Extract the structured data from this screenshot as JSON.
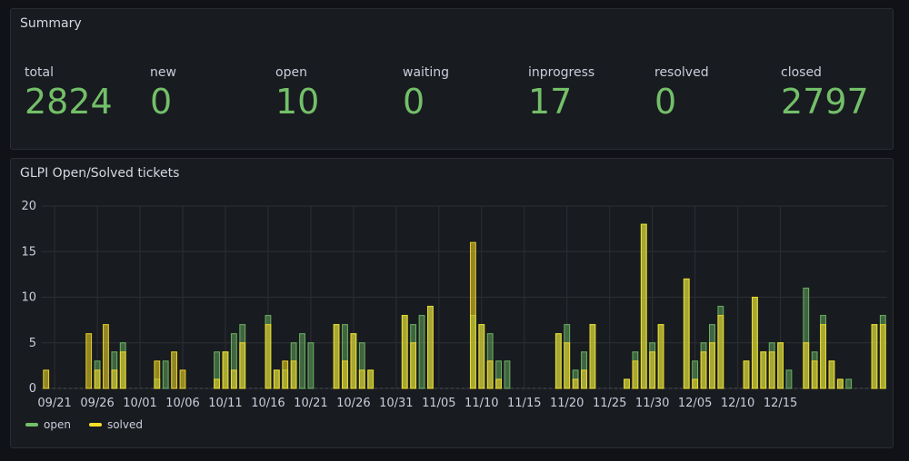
{
  "summary": {
    "title": "Summary",
    "stats": [
      {
        "label": "total",
        "value": "2824"
      },
      {
        "label": "new",
        "value": "0"
      },
      {
        "label": "open",
        "value": "10"
      },
      {
        "label": "waiting",
        "value": "0"
      },
      {
        "label": "inprogress",
        "value": "17"
      },
      {
        "label": "resolved",
        "value": "0"
      },
      {
        "label": "closed",
        "value": "2797"
      }
    ],
    "value_color": "#73bf69"
  },
  "chart_panel": {
    "title": "GLPI Open/Solved tickets"
  },
  "chart_data": {
    "type": "bar",
    "title": "GLPI Open/Solved tickets",
    "x_tick_labels": [
      "09/21",
      "09/26",
      "10/01",
      "10/06",
      "10/11",
      "10/16",
      "10/21",
      "10/26",
      "10/31",
      "11/05",
      "11/10",
      "11/15",
      "11/20",
      "11/25",
      "11/30",
      "12/05",
      "12/10",
      "12/15"
    ],
    "start_date": "09/20",
    "ylim": [
      0,
      20
    ],
    "y_ticks": [
      0,
      5,
      10,
      15,
      20
    ],
    "grid": true,
    "legend_position": "bottom-left",
    "series": [
      {
        "name": "open",
        "color": "#73bf69",
        "values": [
          0,
          0,
          0,
          0,
          0,
          0,
          3,
          0,
          4,
          5,
          0,
          0,
          0,
          1,
          3,
          0,
          0,
          0,
          0,
          0,
          4,
          4,
          6,
          7,
          0,
          0,
          8,
          2,
          2,
          5,
          6,
          5,
          0,
          0,
          7,
          7,
          6,
          5,
          2,
          0,
          0,
          0,
          8,
          7,
          8,
          9,
          0,
          0,
          0,
          0,
          8,
          7,
          6,
          3,
          3,
          0,
          0,
          0,
          0,
          0,
          6,
          7,
          2,
          4,
          7,
          0,
          0,
          0,
          1,
          4,
          18,
          5,
          7,
          0,
          0,
          12,
          3,
          5,
          7,
          9,
          0,
          0,
          3,
          10,
          4,
          5,
          5,
          2,
          0,
          11,
          4,
          8,
          3,
          1,
          1,
          0,
          0,
          7,
          8
        ]
      },
      {
        "name": "solved",
        "color": "#fade2a",
        "values": [
          2,
          0,
          0,
          0,
          0,
          6,
          2,
          7,
          2,
          4,
          0,
          0,
          0,
          3,
          0,
          4,
          2,
          0,
          0,
          0,
          1,
          4,
          2,
          5,
          0,
          0,
          7,
          2,
          3,
          3,
          0,
          0,
          0,
          0,
          7,
          3,
          6,
          2,
          2,
          0,
          0,
          0,
          8,
          5,
          0,
          9,
          0,
          0,
          0,
          0,
          16,
          7,
          3,
          1,
          0,
          0,
          0,
          0,
          0,
          0,
          6,
          5,
          1,
          2,
          7,
          0,
          0,
          0,
          1,
          3,
          18,
          4,
          7,
          0,
          0,
          12,
          1,
          4,
          5,
          8,
          0,
          0,
          3,
          10,
          4,
          4,
          5,
          0,
          0,
          5,
          3,
          7,
          3,
          1,
          0,
          0,
          0,
          7,
          7
        ]
      }
    ]
  }
}
